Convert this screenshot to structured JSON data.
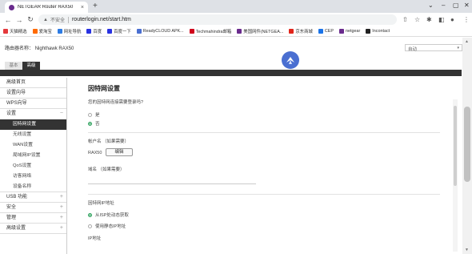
{
  "browser": {
    "tab_title": "NETGEAR Router RAX50",
    "tab_close": "×",
    "new_tab": "+",
    "insecure_label": "不安全",
    "url": "routerlogin.net/start.htm",
    "bookmarks": [
      {
        "label": "天猫精选",
        "color": "#e4393c"
      },
      {
        "label": "爱淘宝",
        "color": "#ff6a00"
      },
      {
        "label": "网址导航",
        "color": "#2d7be3"
      },
      {
        "label": "百度",
        "color": "#2932e1"
      },
      {
        "label": "百度一下",
        "color": "#2932e1"
      },
      {
        "label": "ReadyCLOUD APK...",
        "color": "#4a6fd1"
      },
      {
        "label": "Techmahindra邮箱",
        "color": "#d0021b"
      },
      {
        "label": "美国网件(NETGEA...",
        "color": "#6a2b8d"
      },
      {
        "label": "京东商城",
        "color": "#e1251b"
      },
      {
        "label": "CEP",
        "color": "#1a73e8"
      },
      {
        "label": "netgear",
        "color": "#6a2b8d"
      },
      {
        "label": "Incontact",
        "color": "#222222"
      }
    ]
  },
  "router": {
    "name_label": "路由器名称：",
    "name_value": "Nighthawk RAX50",
    "language": "自动",
    "tab_basic": "基本",
    "tab_advanced": "高级"
  },
  "sidebar": {
    "items": [
      {
        "label": "高级首页",
        "expandable": false
      },
      {
        "label": "设置向导",
        "expandable": false
      },
      {
        "label": "WPS向导",
        "expandable": false
      }
    ],
    "group_label": "设置",
    "group_sign": "−",
    "sub_items": [
      "因特网设置",
      "无线设置",
      "WAN设置",
      "局域网IP设置",
      "QoS设置",
      "访客网络",
      "设备名称"
    ],
    "bottom_items": [
      {
        "label": "USB 功能",
        "sign": "+"
      },
      {
        "label": "安全",
        "sign": "+"
      },
      {
        "label": "管理",
        "sign": "+"
      },
      {
        "label": "高级设置",
        "sign": "+"
      }
    ]
  },
  "form": {
    "title": "因特网设置",
    "question": "您的因特网连接需要登录吗?",
    "opt_yes": "是",
    "opt_no": "否",
    "account_label": "帐户名  （如果需要）",
    "account_value": "RAX50",
    "edit_button": "编辑",
    "domain_label": "域名  （如果需要）",
    "ip_section": "因特网IP地址",
    "ip_dynamic": "从ISP处动态获取",
    "ip_static": "使用静态IP地址",
    "ip_address_label": "IP地址"
  },
  "colors": {
    "accent_green": "#2aa05a",
    "dark_bar": "#333333",
    "logo_blue": "#4a6fd1"
  }
}
